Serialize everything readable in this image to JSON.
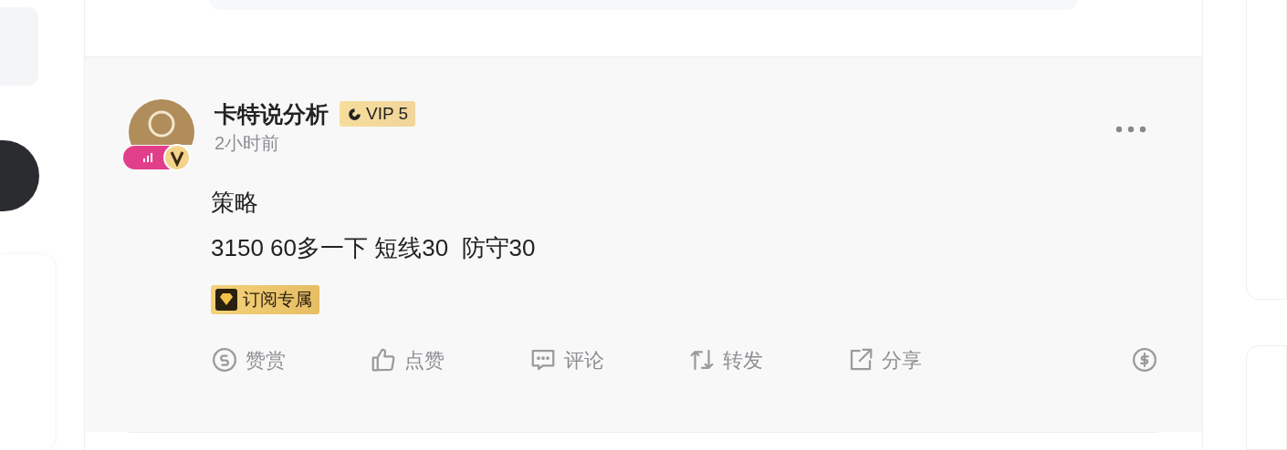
{
  "post": {
    "author": "卡特说分析",
    "vip_badge": "VIP 5",
    "time": "2小时前",
    "verified": true,
    "content": [
      "策略",
      "3150 60多一下 短线30  防守30"
    ],
    "tag": "订阅专属",
    "actions": [
      {
        "kind": "reward",
        "label": "赞赏"
      },
      {
        "kind": "like",
        "label": "点赞"
      },
      {
        "kind": "comment",
        "label": "评论"
      },
      {
        "kind": "repost",
        "label": "转发"
      },
      {
        "kind": "share",
        "label": "分享"
      },
      {
        "kind": "tip"
      }
    ]
  }
}
